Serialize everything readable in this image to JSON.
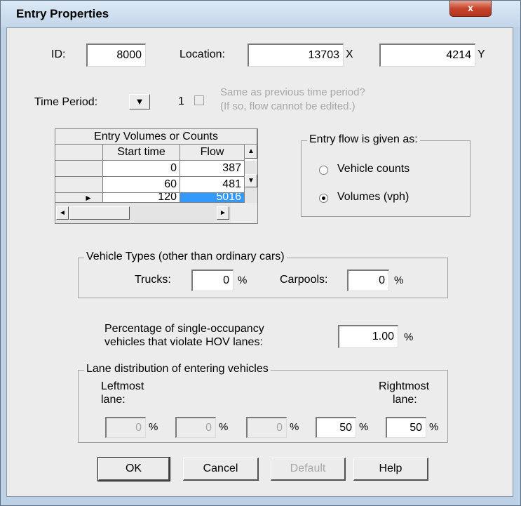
{
  "window": {
    "title": "Entry Properties",
    "close_glyph": "x"
  },
  "id_row": {
    "id_label": "ID:",
    "id_value": "8000",
    "location_label": "Location:",
    "x_value": "13703",
    "x_suffix": "X",
    "y_value": "4214",
    "y_suffix": "Y"
  },
  "time_period": {
    "label": "Time Period:",
    "dropdown_glyph": "▼",
    "value": "1",
    "same_as_previous_line1": "Same as previous time period?",
    "same_as_previous_line2": "(If so, flow cannot be edited.)"
  },
  "volumes_grid": {
    "title": "Entry Volumes or Counts",
    "col_start": "Start time",
    "col_flow": "Flow",
    "rows": [
      {
        "start": "0",
        "flow": "387"
      },
      {
        "start": "60",
        "flow": "481"
      },
      {
        "start": "120",
        "flow": "5016"
      }
    ],
    "row_pointer": "►",
    "scroll_up": "▲",
    "scroll_down": "▼",
    "scroll_left": "◄",
    "scroll_right": "►"
  },
  "flow_type": {
    "title": "Entry flow is given as:",
    "options": [
      "Vehicle counts",
      "Volumes (vph)"
    ],
    "selected": "Volumes (vph)"
  },
  "vehicle_types": {
    "title": "Vehicle Types (other than ordinary cars)",
    "trucks_label": "Trucks:",
    "trucks_value": "0",
    "carpools_label": "Carpools:",
    "carpools_value": "0",
    "pct_sign": "%"
  },
  "hov": {
    "line1": "Percentage of single-occupancy",
    "line2": "vehicles that violate HOV lanes:",
    "value": "1.00",
    "pct_sign": "%"
  },
  "lane_distribution": {
    "title": "Lane distribution of entering vehicles",
    "leftmost_line1": "Leftmost",
    "leftmost_line2": "lane:",
    "rightmost_line1": "Rightmost",
    "rightmost_line2": "lane:",
    "lanes": [
      "0",
      "0",
      "0",
      "50",
      "50"
    ],
    "pct_sign": "%"
  },
  "buttons": {
    "ok": "OK",
    "cancel": "Cancel",
    "default": "Default",
    "help": "Help"
  }
}
